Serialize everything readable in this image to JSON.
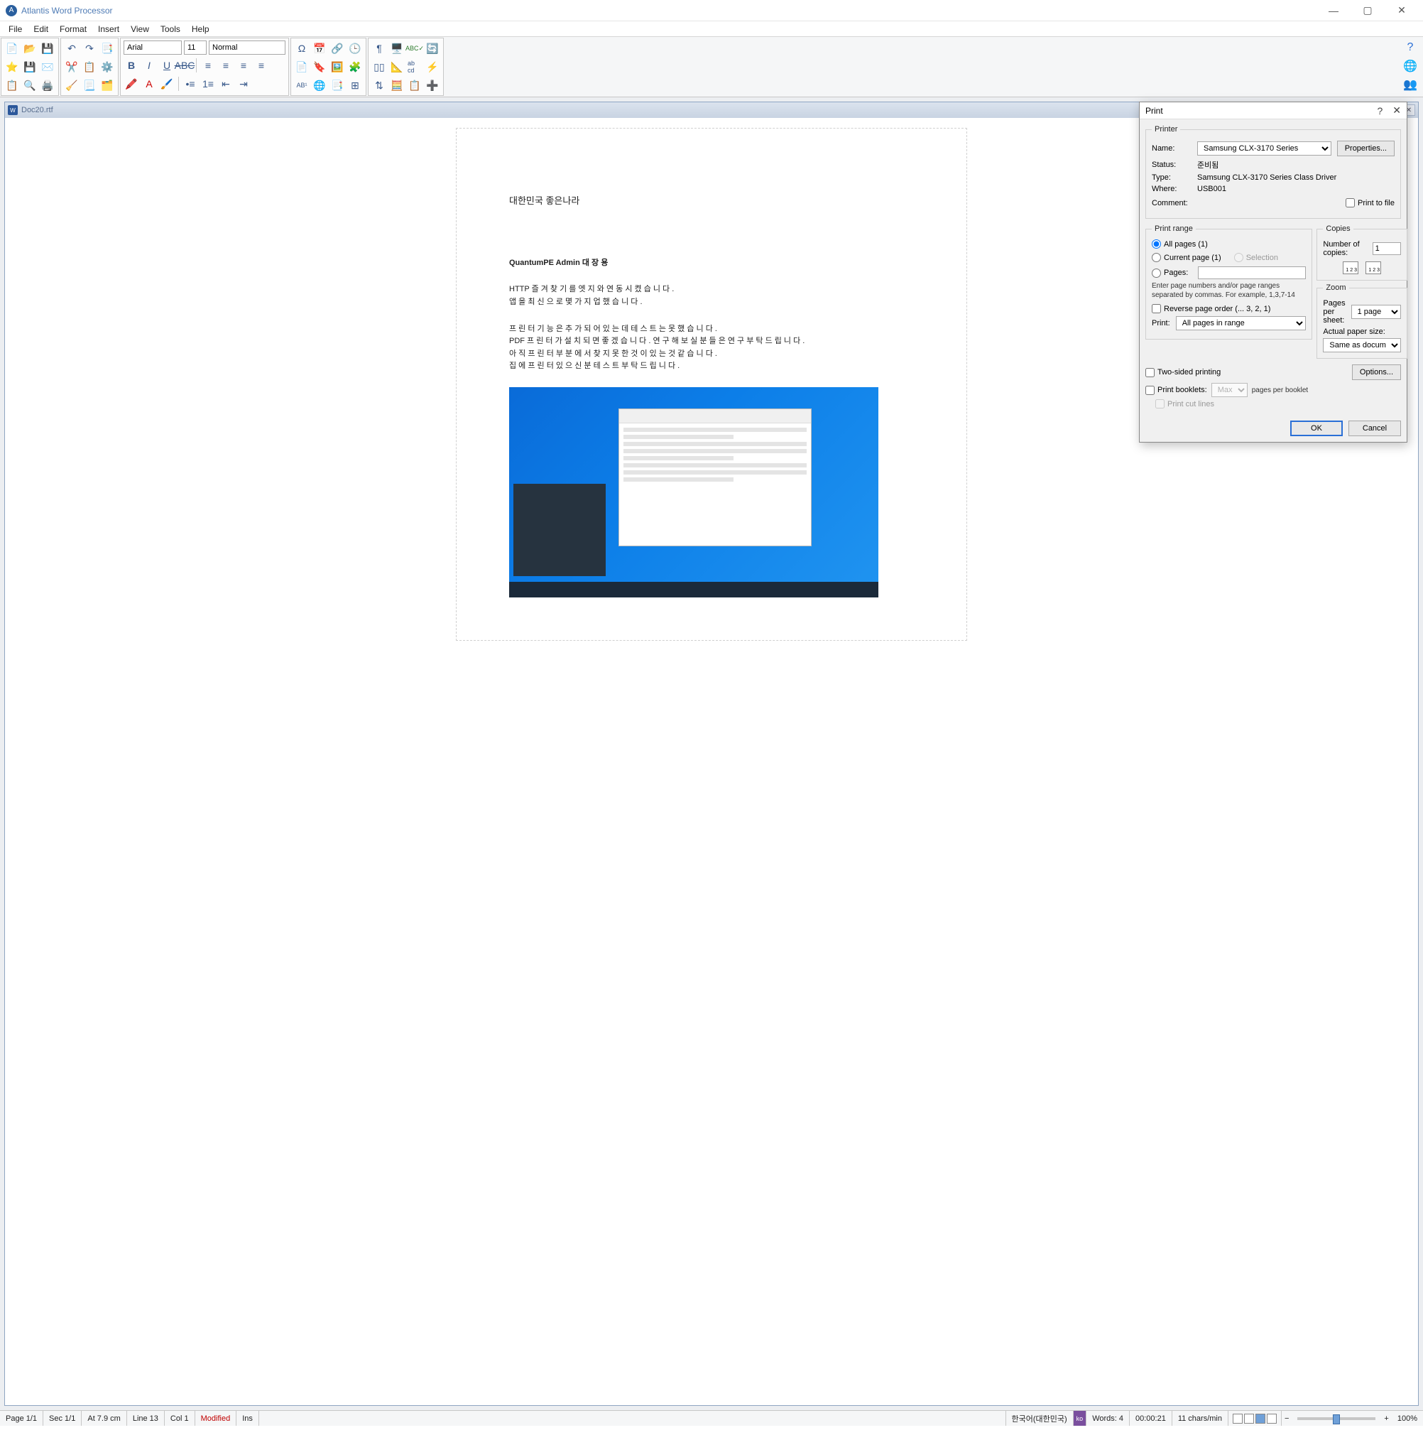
{
  "app": {
    "title": "Atlantis Word Processor"
  },
  "menu": [
    "File",
    "Edit",
    "Format",
    "Insert",
    "View",
    "Tools",
    "Help"
  ],
  "format_bar": {
    "font": "Arial",
    "size": "11",
    "style": "Normal"
  },
  "doc": {
    "filename": "Doc20.rtf",
    "title_line": "대한민국 좋은나라",
    "author_line": "QuantumPE Admin 대 장 용",
    "l1": "HTTP 즐 겨 찾 기 를  엣 지 와  연 동  시 켰 습 니 다 .",
    "l2": "앱 을  최 신 으 로  몇 가 지  업  했 습 니 다 .",
    "l3": "프 린 터  기 능 은  추 가 되 어  있 는 데  테 스 트 는  못 했 습 니 다 .",
    "l4": "PDF 프 린 터 가  설 치 되 면  좋 겠 습 니 다 . 연 구 해  보 실 분 들 은  연 구  부 탁 드 립 니 다 .",
    "l5": "아 직  프 린 터  부 분 에 서  찾 지  못 한 것 이  있 는 것  같 습 니 다 .",
    "l6": "집 에  프 린 터  있 으 신 분  테 스 트  부 탁 드 립 니 다 ."
  },
  "print": {
    "title": "Print",
    "printer_group": "Printer",
    "name_lbl": "Name:",
    "name_val": "Samsung CLX-3170 Series",
    "properties_btn": "Properties...",
    "status_lbl": "Status:",
    "status_val": "준비됨",
    "type_lbl": "Type:",
    "type_val": "Samsung CLX-3170 Series Class Driver",
    "where_lbl": "Where:",
    "where_val": "USB001",
    "comment_lbl": "Comment:",
    "print_to_file": "Print to file",
    "range_group": "Print range",
    "all_pages": "All pages (1)",
    "current_page": "Current page (1)",
    "selection": "Selection",
    "pages_lbl": "Pages:",
    "pages_hint": "Enter page numbers and/or page ranges separated by commas. For example, 1,3,7-14",
    "reverse": "Reverse page order (... 3, 2, 1)",
    "print_lbl": "Print:",
    "print_scope": "All pages in range",
    "copies_group": "Copies",
    "ncopies_lbl": "Number of copies:",
    "ncopies_val": "1",
    "zoom_group": "Zoom",
    "pps_lbl": "Pages per sheet:",
    "pps_val": "1 page",
    "aps_lbl": "Actual paper size:",
    "aps_val": "Same as document page size",
    "two_sided": "Two-sided printing",
    "options_btn": "Options...",
    "booklets_lbl": "Print booklets:",
    "booklets_val": "Max",
    "booklets_unit": "pages per booklet",
    "cut_lines": "Print cut lines",
    "ok": "OK",
    "cancel": "Cancel"
  },
  "status": {
    "page": "Page 1/1",
    "sec": "Sec 1/1",
    "pos": "At 7.9 cm",
    "line": "Line 13",
    "col": "Col 1",
    "modified": "Modified",
    "ins": "Ins",
    "lang": "한국어(대한민국)",
    "kb": "ko",
    "words": "Words: 4",
    "time": "00:00:21",
    "cpm": "11 chars/min",
    "zoom": "100%"
  }
}
